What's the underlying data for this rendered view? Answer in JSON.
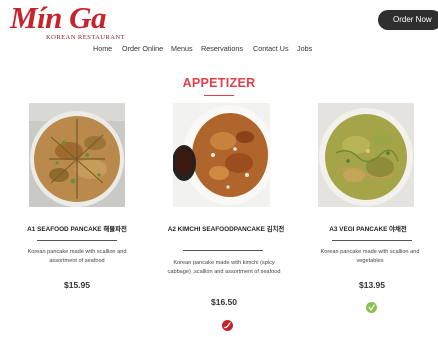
{
  "brand": {
    "name": "Mín Ga",
    "subtitle": "KOREAN RESTAURANT",
    "color": "#c8232c"
  },
  "header": {
    "order_now_label": "Order Now"
  },
  "nav": {
    "items": [
      {
        "label": "Home"
      },
      {
        "label": "Order Online"
      },
      {
        "label": "Menus"
      },
      {
        "label": "Reservations"
      },
      {
        "label": "Contact Us"
      },
      {
        "label": "Jobs"
      }
    ]
  },
  "section": {
    "title": "APPETIZER",
    "accent_color": "#e0404a"
  },
  "menu_items": [
    {
      "name": "A1 SEAFOOD PANCAKE 해물파전",
      "description": "Korean pancake made with scallion and assortment of seafood",
      "price": "$15.95",
      "badge_icon": null,
      "badge_color": null
    },
    {
      "name": "A2 KIMCHI SEAFOODPANCAKE 김치전",
      "description": "Korean pancake made with kimchi (spicy cabbage) ,scallion and assortment of seafood",
      "price": "$16.50",
      "badge_icon": "chili-pepper-icon",
      "badge_color": "#c8232c"
    },
    {
      "name": "A3 VEGI PANCAKE 야채전",
      "description": "Korean pancake made with scallion and vegetables",
      "price": "$13.95",
      "badge_icon": "vegetarian-leaf-icon",
      "badge_color": "#8bbf4f"
    }
  ]
}
